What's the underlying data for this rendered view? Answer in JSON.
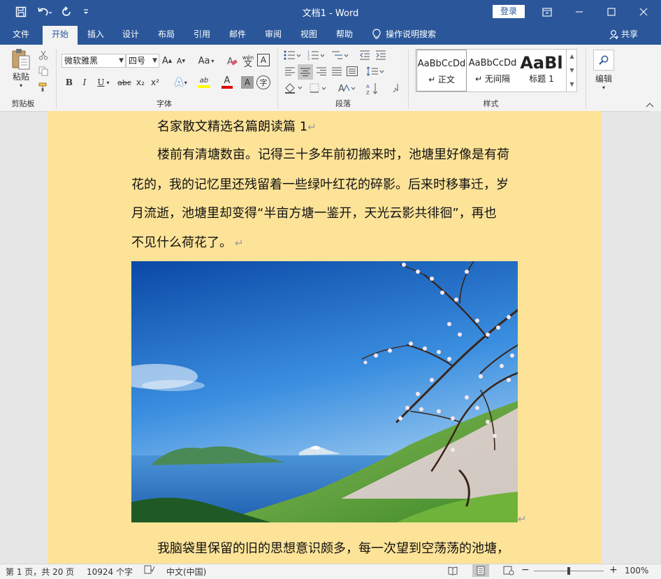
{
  "titlebar": {
    "title": "文档1  -  Word",
    "login": "登录",
    "save_icon": "save-icon",
    "undo_icon": "undo-icon",
    "redo_icon": "redo-icon",
    "customize_icon": "customize-icon"
  },
  "tabs": [
    "文件",
    "开始",
    "插入",
    "设计",
    "布局",
    "引用",
    "邮件",
    "审阅",
    "视图",
    "帮助"
  ],
  "tab_active": "开始",
  "tell_me": "操作说明搜索",
  "share": "共享",
  "ribbon": {
    "clipboard": {
      "paste": "粘贴",
      "label": "剪贴板"
    },
    "font": {
      "name": "微软雅黑",
      "size": "四号",
      "label": "字体",
      "grow": "A",
      "shrink": "A",
      "case": "Aa",
      "bold": "B",
      "italic": "I",
      "underline": "U",
      "strike": "abc",
      "sub": "x₂",
      "sup": "x²",
      "pinyin": "wén",
      "clear": "A",
      "boxA": "A",
      "highlight": "ab",
      "color": "A",
      "shade": "A",
      "circle": "字"
    },
    "paragraph": {
      "label": "段落"
    },
    "styles": {
      "label": "样式",
      "items": [
        {
          "sample": "AaBbCcDd",
          "name": "↵ 正文"
        },
        {
          "sample": "AaBbCcDd",
          "name": "↵ 无间隔"
        },
        {
          "sample": "AaBl",
          "name": "标题 1"
        }
      ]
    },
    "editing": {
      "label": "编辑"
    }
  },
  "document": {
    "heading": "名家散文精选名篇朗读篇 1",
    "para1": [
      "楼前有清塘数亩。记得三十多年前初搬来时，池塘里好像是有荷",
      "花的，我的记忆里还残留着一些绿叶红花的碎影。后来时移事迁，岁",
      "月流逝，池塘里却变得“半亩方塘一鉴开，天光云影共徘徊”，再也",
      "不见什么荷花了。"
    ],
    "para2": "我脑袋里保留的旧的思想意识颇多，每一次望到空荡荡的池塘，",
    "pilcrow": "↵"
  },
  "status": {
    "page": "第 1 页，共 20 页",
    "words": "10924 个字",
    "lang": "中文(中国)",
    "zoom": "100%",
    "minus": "−",
    "plus": "+"
  },
  "colors": {
    "brand": "#2b579a",
    "page_bg": "#fde398"
  }
}
